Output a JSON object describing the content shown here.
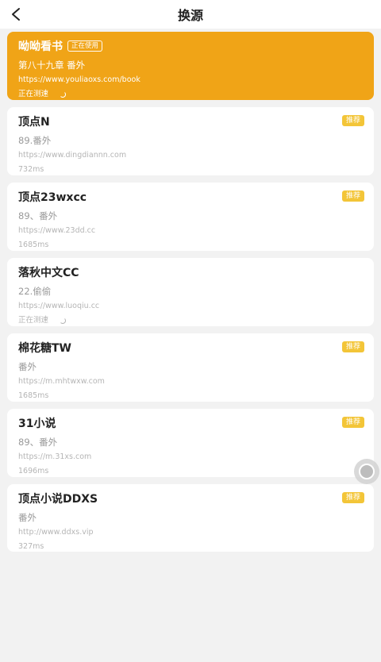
{
  "header": {
    "title": "换源"
  },
  "colors": {
    "active_bg": "#f0a417",
    "badge_bg": "#f3c538"
  },
  "sources": [
    {
      "name": "呦呦看书",
      "badge": "正在使用",
      "chapter": "第八十九章 番外",
      "url": "https://www.youliaoxs.com/book",
      "status": "正在测速",
      "active": true
    },
    {
      "name": "顶点N",
      "badge": "推荐",
      "chapter": "89.番外",
      "url": "https://www.dingdiannn.com",
      "status": "732ms"
    },
    {
      "name": "顶点23wxcc",
      "badge": "推荐",
      "chapter": "89、番外",
      "url": "https://www.23dd.cc",
      "status": "1685ms"
    },
    {
      "name": "落秋中文CC",
      "badge": "",
      "chapter": "22.偷偷",
      "url": "https://www.luoqiu.cc",
      "status": "正在测速"
    },
    {
      "name": "棉花糖TW",
      "badge": "推荐",
      "chapter": "番外",
      "url": "https://m.mhtwxw.com",
      "status": "1685ms"
    },
    {
      "name": "31小说",
      "badge": "推荐",
      "chapter": "89、番外",
      "url": "https://m.31xs.com",
      "status": "1696ms"
    },
    {
      "name": "顶点小说DDXS",
      "badge": "推荐",
      "chapter": "番外",
      "url": "http://www.ddxs.vip",
      "status": "327ms"
    }
  ]
}
